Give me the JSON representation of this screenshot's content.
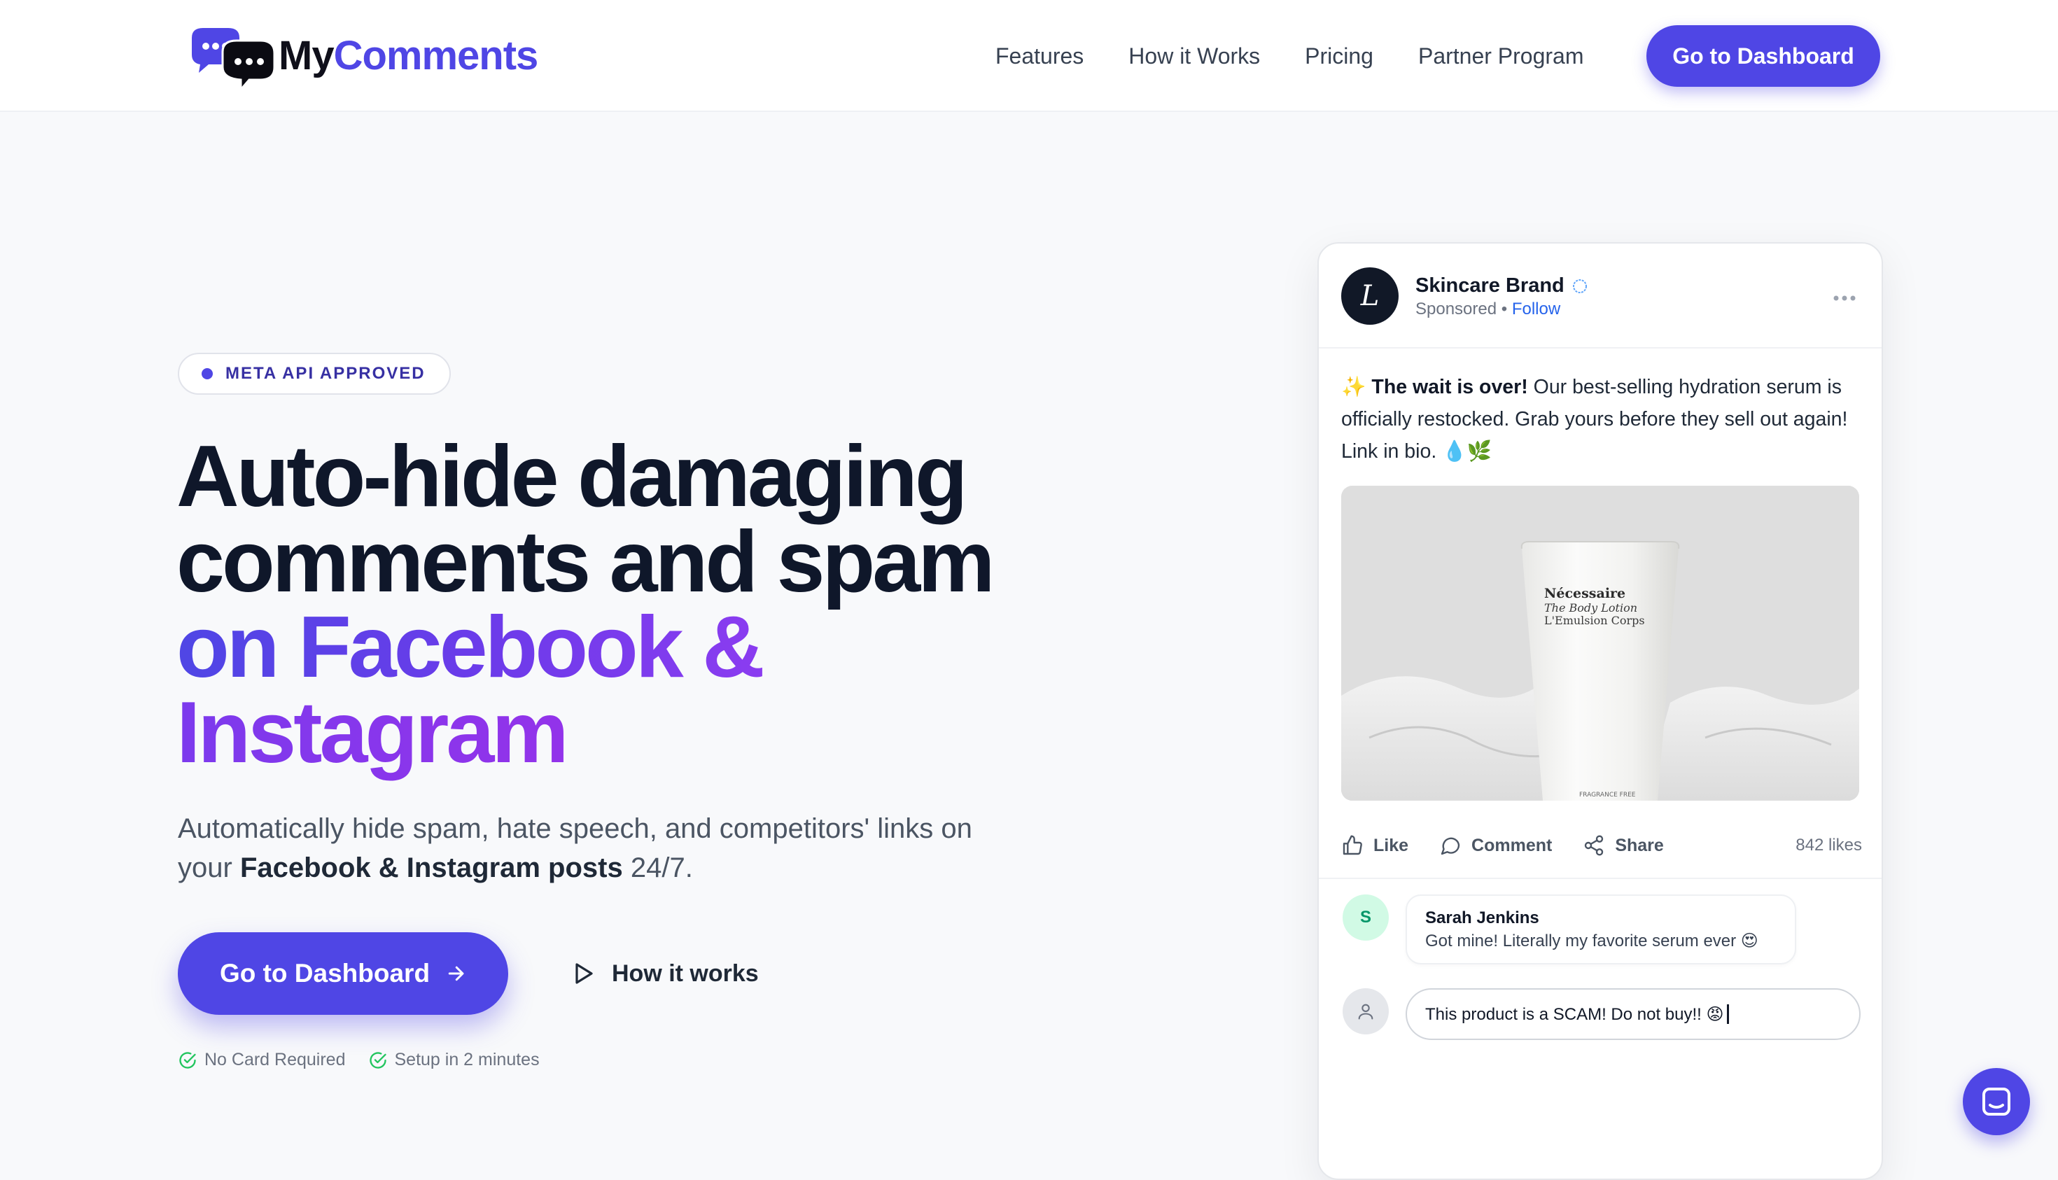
{
  "brand": {
    "logo_my": "My",
    "logo_comments": "Comments"
  },
  "nav": {
    "links": [
      "Features",
      "How it Works",
      "Pricing",
      "Partner Program"
    ],
    "cta": "Go to Dashboard"
  },
  "hero": {
    "badge": "META API APPROVED",
    "headline_line1": "Auto-hide damaging",
    "headline_line2": "comments and spam",
    "headline_line3": "on Facebook &",
    "headline_line4": "Instagram",
    "subtitle_part1": "Automatically hide spam, hate speech, and competitors' links on your ",
    "subtitle_bold": "Facebook & Instagram posts",
    "subtitle_part2": " 24/7.",
    "cta_primary": "Go to Dashboard",
    "cta_secondary": "How it works",
    "trust": [
      "No Card Required",
      "Setup in 2 minutes"
    ]
  },
  "post": {
    "avatar_letter": "L",
    "brand_name": "Skincare Brand",
    "sponsored": "Sponsored",
    "separator": "•",
    "follow": "Follow",
    "text_emoji": "✨",
    "text_bold": "The wait is over!",
    "text_rest": " Our best-selling hydration serum is officially restocked. Grab yours before they sell out again! Link in bio. 💧🌿",
    "product_label_1": "Nécessaire",
    "product_label_2": "The Body Lotion",
    "product_label_3": "L'Emulsion Corps",
    "product_label_4": "FRAGRANCE FREE",
    "actions": {
      "like": "Like",
      "comment": "Comment",
      "share": "Share"
    },
    "likes": "842 likes",
    "comment": {
      "avatar_letter": "S",
      "author": "Sarah Jenkins",
      "text": "Got mine! Literally my favorite serum ever 😍"
    },
    "input_value": "This product is a SCAM! Do not buy!! 😡"
  },
  "colors": {
    "accent": "#4f46e5",
    "headline_dark": "#0f172a",
    "gradient_start": "#4f46e5",
    "gradient_end": "#9333ea",
    "success": "#22c55e"
  },
  "icons": [
    "chat-bubbles-logo-icon",
    "arrow-right-icon",
    "play-icon",
    "check-circle-icon",
    "verified-icon",
    "more-dots-icon",
    "thumbs-up-icon",
    "comment-icon",
    "share-icon",
    "user-icon",
    "chat-launcher-icon"
  ]
}
